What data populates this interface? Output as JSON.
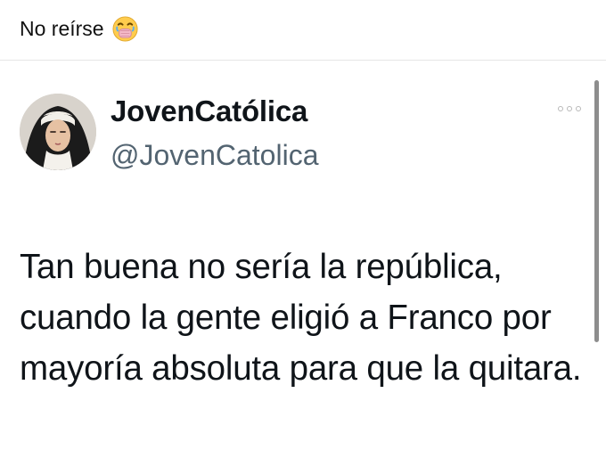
{
  "post": {
    "caption": "No reírse",
    "caption_emoji": "hand-over-mouth-laughing-emoji"
  },
  "tweet": {
    "display_name": "JovenCatólica",
    "handle": "@JovenCatolica",
    "avatar": "nun-portrait-avatar",
    "more_icon": "more-options-icon",
    "text": "Tan buena no sería la república, cuando la gente eligió a Franco por mayoría absoluta para que la quitara."
  }
}
